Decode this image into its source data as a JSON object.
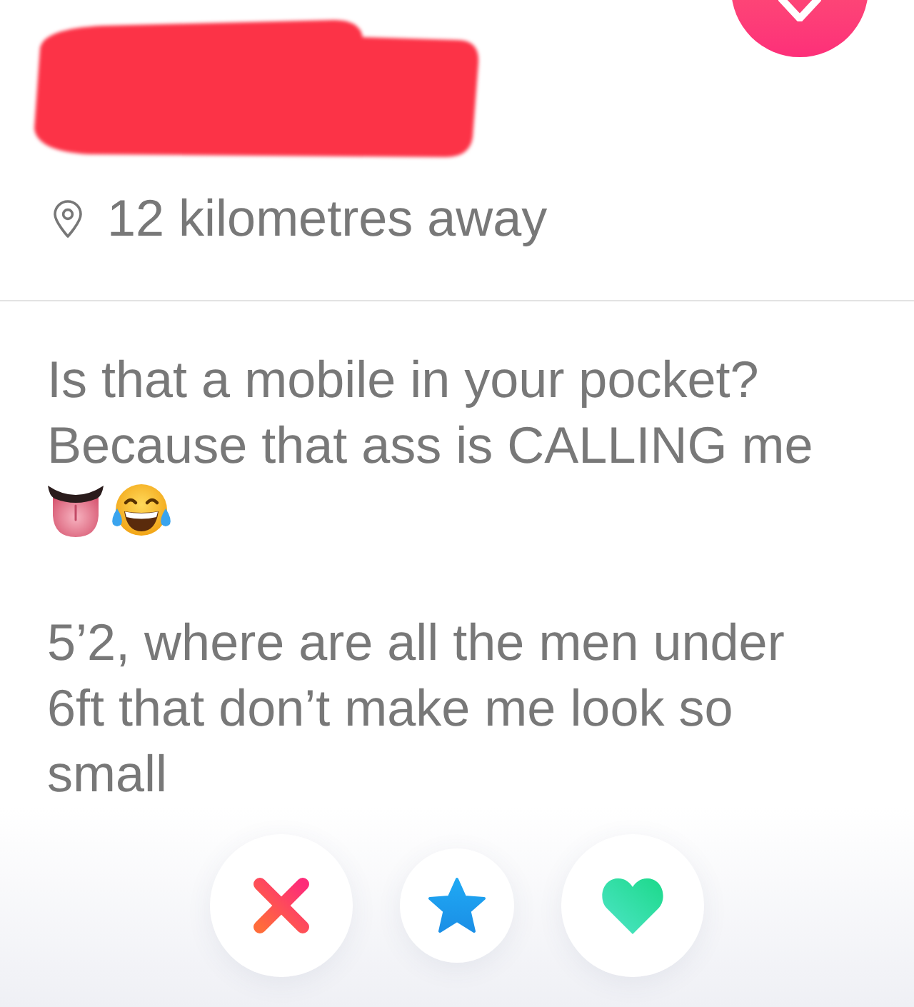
{
  "profile": {
    "distance": "12 kilometres away"
  },
  "bio": {
    "paragraphs": [
      {
        "lines": [
          "Is that a mobile in your pocket?",
          "Because that ass is CALLING me"
        ]
      },
      {
        "lines": [
          "5’2, where are all the men under",
          "6ft that don’t make me look so",
          "small"
        ]
      }
    ]
  }
}
